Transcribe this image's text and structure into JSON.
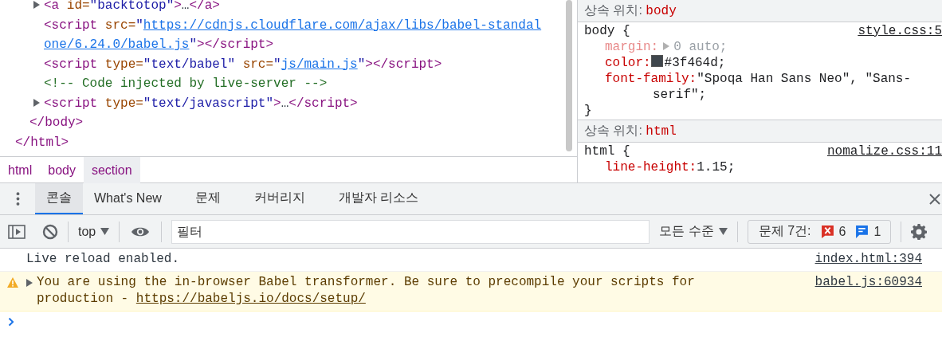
{
  "elements": {
    "nodes": [
      {
        "children": [
          {
            "children": [
              {
                "expanded": false,
                "tokens": [
                  {
                    "kind": "tag",
                    "text": "<a"
                  },
                  {
                    "kind": "attr",
                    "text": " id="
                  },
                  {
                    "kind": "value",
                    "text": "\"backtotop\""
                  },
                  {
                    "kind": "tag",
                    "text": ">"
                  },
                  {
                    "kind": "plain",
                    "text": "…"
                  },
                  {
                    "kind": "tag",
                    "text": "</a>"
                  }
                ]
              },
              {
                "tokens": [
                  {
                    "kind": "tag",
                    "text": "<script"
                  },
                  {
                    "kind": "attr",
                    "text": " src="
                  },
                  {
                    "kind": "value",
                    "text": "\""
                  },
                  {
                    "kind": "link",
                    "text": "https://cdnjs.cloudflare.com/ajax/libs/babel-standalone/6.24.0/babel.js"
                  },
                  {
                    "kind": "value",
                    "text": "\""
                  },
                  {
                    "kind": "tag",
                    "text": "></script>"
                  }
                ]
              },
              {
                "tokens": [
                  {
                    "kind": "tag",
                    "text": "<script"
                  },
                  {
                    "kind": "attr",
                    "text": " type="
                  },
                  {
                    "kind": "value",
                    "text": "\"text/babel\""
                  },
                  {
                    "kind": "attr",
                    "text": " src="
                  },
                  {
                    "kind": "value",
                    "text": "\""
                  },
                  {
                    "kind": "link",
                    "text": "js/main.js"
                  },
                  {
                    "kind": "value",
                    "text": "\""
                  },
                  {
                    "kind": "tag",
                    "text": "></script>"
                  }
                ]
              },
              {
                "tokens": [
                  {
                    "kind": "comment",
                    "text": "<!-- Code injected by live-server -->"
                  }
                ]
              },
              {
                "expanded": false,
                "tokens": [
                  {
                    "kind": "tag",
                    "text": "<script"
                  },
                  {
                    "kind": "attr",
                    "text": " type="
                  },
                  {
                    "kind": "value",
                    "text": "\"text/javascript\""
                  },
                  {
                    "kind": "tag",
                    "text": ">"
                  },
                  {
                    "kind": "plain",
                    "text": "…"
                  },
                  {
                    "kind": "tag",
                    "text": "</script>"
                  }
                ]
              }
            ],
            "close": [
              {
                "kind": "tag",
                "text": "</body>"
              }
            ]
          }
        ],
        "close": [
          {
            "kind": "tag",
            "text": "</html>"
          }
        ]
      }
    ]
  },
  "breadcrumbs": [
    {
      "label": "html",
      "selected": false
    },
    {
      "label": "body",
      "selected": false
    },
    {
      "label": "section",
      "selected": true
    }
  ],
  "styles": {
    "sections": [
      {
        "kind": "inherited",
        "label": "상속 위치:",
        "element": "body"
      },
      {
        "kind": "rule",
        "selector": "body {",
        "source": "style.css:5",
        "close": "}",
        "declarations": [
          {
            "property": "margin:",
            "value": "0 auto;",
            "overridden": true,
            "expandable": true
          },
          {
            "property": "color:",
            "value": "#3f464d;",
            "swatch": true
          },
          {
            "property": "font-family:",
            "value": "\"Spoqa Han Sans Neo\", \"Sans-serif\";"
          }
        ]
      },
      {
        "kind": "inherited",
        "label": "상속 위치:",
        "element": "html"
      },
      {
        "kind": "rule",
        "selector": "html {",
        "source": "nomalize.css:11",
        "declarations": [
          {
            "property": "line-height:",
            "value": "1.15;"
          }
        ]
      }
    ]
  },
  "drawer": {
    "tabs": [
      {
        "label": "콘솔",
        "selected": true
      },
      {
        "label": "What's New",
        "selected": false
      },
      {
        "label": "문제",
        "selected": false
      },
      {
        "label": "커버리지",
        "selected": false
      },
      {
        "label": "개발자 리소스",
        "selected": false
      }
    ]
  },
  "toolbar": {
    "context": "top",
    "filter": {
      "placeholder": "필터"
    },
    "levels": "모든 수준",
    "issues": {
      "label": "문제 7건:",
      "errors": "6",
      "infos": "1"
    }
  },
  "messages": [
    {
      "kind": "log",
      "text": "Live reload enabled.",
      "source": "index.html:394"
    },
    {
      "kind": "warning",
      "expanded": false,
      "text": "You are using the in-browser Babel transformer. Be sure to precompile your scripts for production - ",
      "link": "https://babeljs.io/docs/setup/",
      "source": "babel.js:60934"
    }
  ]
}
